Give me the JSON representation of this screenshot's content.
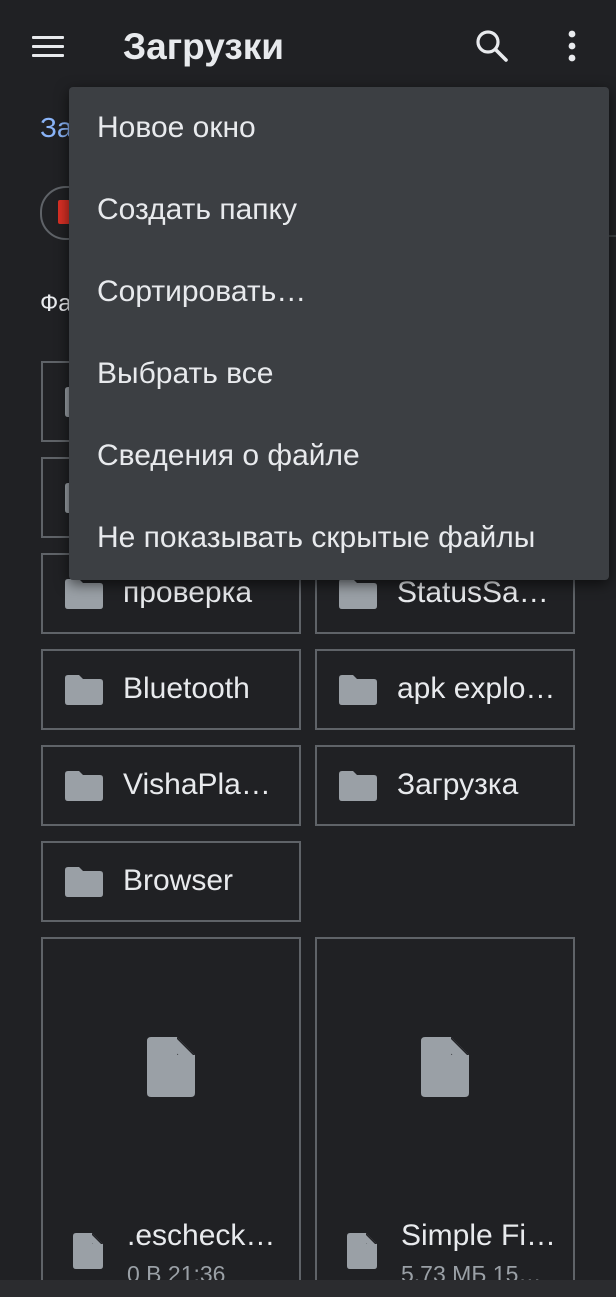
{
  "appbar": {
    "title": "Загрузки"
  },
  "breadcrumb": {
    "text": "За"
  },
  "section": {
    "label": "Фа"
  },
  "folders": [
    {
      "name": ""
    },
    {
      "name": ""
    },
    {
      "name": "проверка"
    },
    {
      "name": "StatusSa…"
    },
    {
      "name": "Bluetooth"
    },
    {
      "name": "apk explo…"
    },
    {
      "name": "VishaPla…"
    },
    {
      "name": "Загрузка"
    },
    {
      "name": "Browser"
    }
  ],
  "files": [
    {
      "name": ".escheck…",
      "meta": "0 В 21:36"
    },
    {
      "name": "Simple Fi…",
      "meta": "5,73 МБ 15…"
    }
  ],
  "overflow_menu": {
    "items": [
      {
        "label": "Новое окно"
      },
      {
        "label": "Создать папку"
      },
      {
        "label": "Сортировать…"
      },
      {
        "label": "Выбрать все"
      },
      {
        "label": "Сведения о файле"
      },
      {
        "label": "Не показывать скрытые файлы"
      }
    ]
  },
  "icons": {
    "menu": "hamburger-icon",
    "search": "search-icon",
    "more": "more-vert-icon",
    "folder": "folder-icon",
    "file": "file-icon"
  },
  "colors": {
    "background": "#202124",
    "menu_surface": "#3c3f43",
    "accent": "#8ab4f8",
    "border": "#5f6368",
    "icon": "#9aa0a6"
  }
}
